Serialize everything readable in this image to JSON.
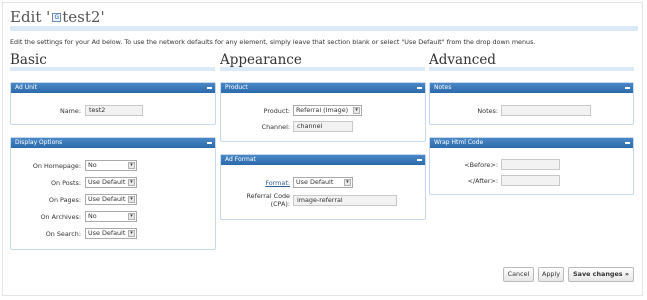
{
  "header": {
    "title_prefix": "Edit '",
    "title_icon_glyph": "G",
    "title_name": "test2",
    "title_suffix": "'",
    "intro": "Edit the settings for your Ad below. To use the network defaults for any element, simply leave that section blank or select \"Use Default\" from the drop down menus."
  },
  "columns": {
    "basic": "Basic",
    "appearance": "Appearance",
    "advanced": "Advanced"
  },
  "ad_unit": {
    "title": "Ad Unit",
    "name_label": "Name:",
    "name_value": "test2"
  },
  "display_options": {
    "title": "Display Options",
    "rows": [
      {
        "label": "On Homepage:",
        "value": "No"
      },
      {
        "label": "On Posts:",
        "value": "Use Default"
      },
      {
        "label": "On Pages:",
        "value": "Use Default"
      },
      {
        "label": "On Archives:",
        "value": "No"
      },
      {
        "label": "On Search:",
        "value": "Use Default"
      }
    ]
  },
  "product": {
    "title": "Product",
    "product_label": "Product:",
    "product_value": "Referral (Image)",
    "channel_label": "Channel:",
    "channel_value": "channel"
  },
  "ad_format": {
    "title": "Ad Format",
    "format_label": "Format:",
    "format_value": "Use Default",
    "referral_label_1": "Referral Code",
    "referral_label_2": "(CPA):",
    "referral_value": "image-referral"
  },
  "notes": {
    "title": "Notes",
    "notes_label": "Notes:",
    "notes_value": ""
  },
  "wrap_html": {
    "title": "Wrap Html Code",
    "before_label": "<Before>:",
    "before_value": "",
    "after_label": "</After>:",
    "after_value": ""
  },
  "footer": {
    "cancel": "Cancel",
    "apply": "Apply",
    "save": "Save changes »"
  },
  "colors": {
    "box_header": "#2d6fb5",
    "rule": "#dce9f7"
  },
  "icons": {
    "collapse": "minus-icon",
    "select_arrow": "chevron-down-icon"
  }
}
